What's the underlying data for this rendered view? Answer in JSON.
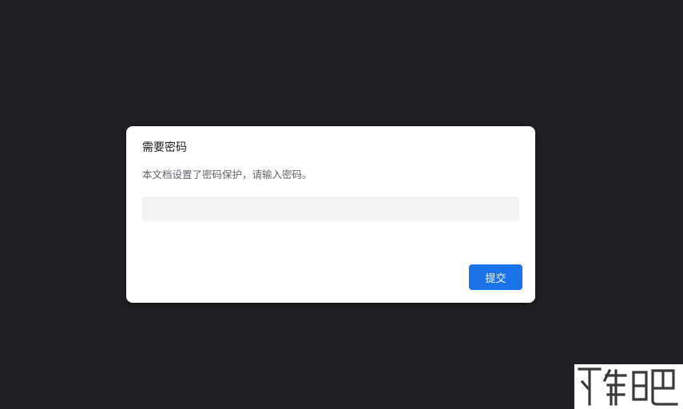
{
  "dialog": {
    "title": "需要密码",
    "message": "本文档设置了密码保护，请输入密码。",
    "password_value": "",
    "password_placeholder": "",
    "submit_label": "提交"
  },
  "colors": {
    "backdrop": "#202124",
    "dialog_background": "#ffffff",
    "input_background": "#f1f3f4",
    "accent": "#1a73e8"
  },
  "watermark": {
    "icon": "site-logo-watermark-icon"
  }
}
